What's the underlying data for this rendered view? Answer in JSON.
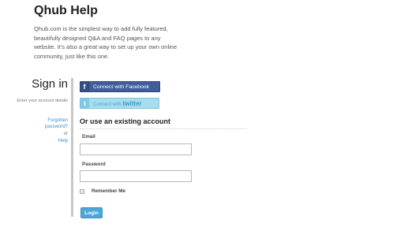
{
  "header": {
    "title": "Qhub Help",
    "intro": "Qhub.com is the simplest way to add fully featured, beautifully designed Q&A and FAQ pages to any website. It's also a great way to set up your own online community, just like this one."
  },
  "sidebar": {
    "title": "Sign in",
    "hint": "Enter your account details",
    "forgot_link": "Forgotten password?",
    "or_text": "or",
    "help_link": "Help"
  },
  "social": {
    "facebook_icon": "f",
    "facebook_label": "Connect with Facebook",
    "twitter_icon": "t",
    "twitter_prefix": "Connect with",
    "twitter_brand": "twitter"
  },
  "form": {
    "heading": "Or use an existing account",
    "email_label": "Email",
    "email_value": "",
    "password_label": "Password",
    "password_value": "",
    "remember_label": "Remember Me",
    "remember_checked": false,
    "login_label": "Login"
  },
  "colors": {
    "link": "#3d8fc7",
    "facebook": "#415e9b",
    "twitter": "#a8dcef",
    "login": "#4ba7d8"
  }
}
